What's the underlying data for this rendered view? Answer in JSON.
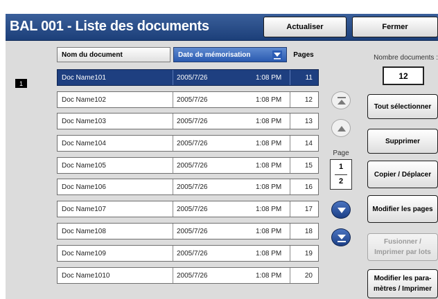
{
  "header": {
    "title": "BAL 001 - Liste des documents",
    "refresh_label": "Actualiser",
    "close_label": "Fermer"
  },
  "list": {
    "row_indicator": "1",
    "columns": {
      "name": "Nom du document",
      "date": "Date de mémorisation",
      "pages": "Pages"
    },
    "rows": [
      {
        "name": "Doc Name101",
        "date": "2005/7/26",
        "time": "1:08 PM",
        "pages": "11",
        "selected": true
      },
      {
        "name": "Doc Name102",
        "date": "2005/7/26",
        "time": "1:08 PM",
        "pages": "12"
      },
      {
        "name": "Doc Name103",
        "date": "2005/7/26",
        "time": "1:08 PM",
        "pages": "13"
      },
      {
        "name": "Doc Name104",
        "date": "2005/7/26",
        "time": "1:08 PM",
        "pages": "14"
      },
      {
        "name": "Doc Name105",
        "date": "2005/7/26",
        "time": "1:08 PM",
        "pages": "15"
      },
      {
        "name": "Doc Name106",
        "date": "2005/7/26",
        "time": "1:08 PM",
        "pages": "16"
      },
      {
        "name": "Doc Name107",
        "date": "2005/7/26",
        "time": "1:08 PM",
        "pages": "17"
      },
      {
        "name": "Doc Name108",
        "date": "2005/7/26",
        "time": "1:08 PM",
        "pages": "18"
      },
      {
        "name": "Doc Name109",
        "date": "2005/7/26",
        "time": "1:08 PM",
        "pages": "19"
      },
      {
        "name": "Doc Name1010",
        "date": "2005/7/26",
        "time": "1:08 PM",
        "pages": "20"
      }
    ]
  },
  "pager": {
    "label": "Page",
    "current": "1",
    "total": "2"
  },
  "side": {
    "count_label": "Nombre documents :",
    "count_value": "12",
    "select_all": "Tout sélectionner",
    "delete": "Supprimer",
    "copy_move": "Copier / Déplacer",
    "edit_pages": "Modifier les pages",
    "merge_batch_line1": "Fusionner /",
    "merge_batch_line2": "Imprimer par lots",
    "edit_settings_line1": "Modifier les para-",
    "edit_settings_line2": "mètres / Imprimer"
  },
  "colors": {
    "title_bar": "#1c3f79",
    "selected_row": "#1e3f80",
    "sort_header": "#2a5ab0",
    "panel_bg": "#dcdcdc"
  }
}
